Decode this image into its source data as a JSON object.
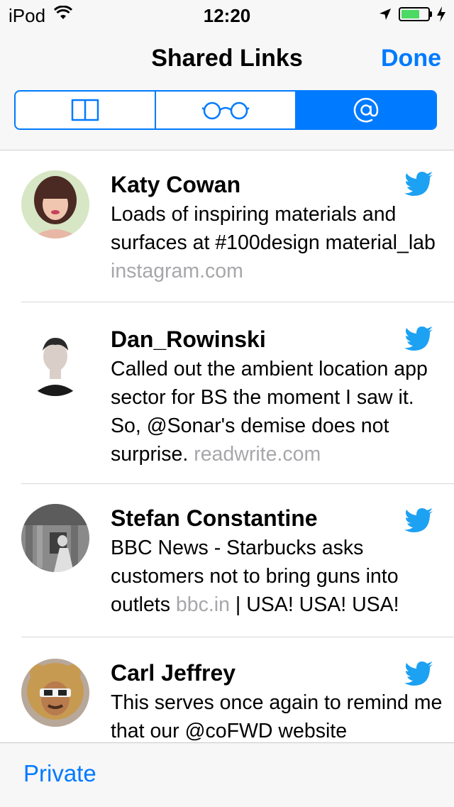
{
  "status_bar": {
    "carrier": "iPod",
    "time": "12:20",
    "battery_percent": 70
  },
  "nav": {
    "title": "Shared Links",
    "done_label": "Done"
  },
  "segments": [
    {
      "icon": "book-icon",
      "active": false
    },
    {
      "icon": "glasses-icon",
      "active": false
    },
    {
      "icon": "at-icon",
      "active": true
    }
  ],
  "links": [
    {
      "name": "Katy Cowan",
      "text": "Loads of inspiring materials and surfaces at #100design material_lab",
      "domain": "instagram.com",
      "suffix": "",
      "icon": "twitter-bird-icon"
    },
    {
      "name": "Dan_Rowinski",
      "text": "Called out the ambient location app sector for BS the moment I saw it. So, @Sonar's demise does not surprise.",
      "domain": "readwrite.com",
      "suffix": "",
      "icon": "twitter-bird-icon"
    },
    {
      "name": "Stefan Constantine",
      "text": "BBC News - Starbucks asks customers not to bring guns into outlets",
      "domain": "bbc.in",
      "suffix": "| USA! USA! USA!",
      "icon": "twitter-bird-icon"
    },
    {
      "name": "Carl Jeffrey",
      "text": "This serves once again to remind me that our @coFWD website",
      "domain": "",
      "suffix": "",
      "icon": "twitter-bird-icon"
    }
  ],
  "toolbar": {
    "private_label": "Private"
  },
  "colors": {
    "accent": "#007aff",
    "twitter": "#1da1f2",
    "domain_gray": "#a7a7ab",
    "battery_green": "#4cd964"
  }
}
